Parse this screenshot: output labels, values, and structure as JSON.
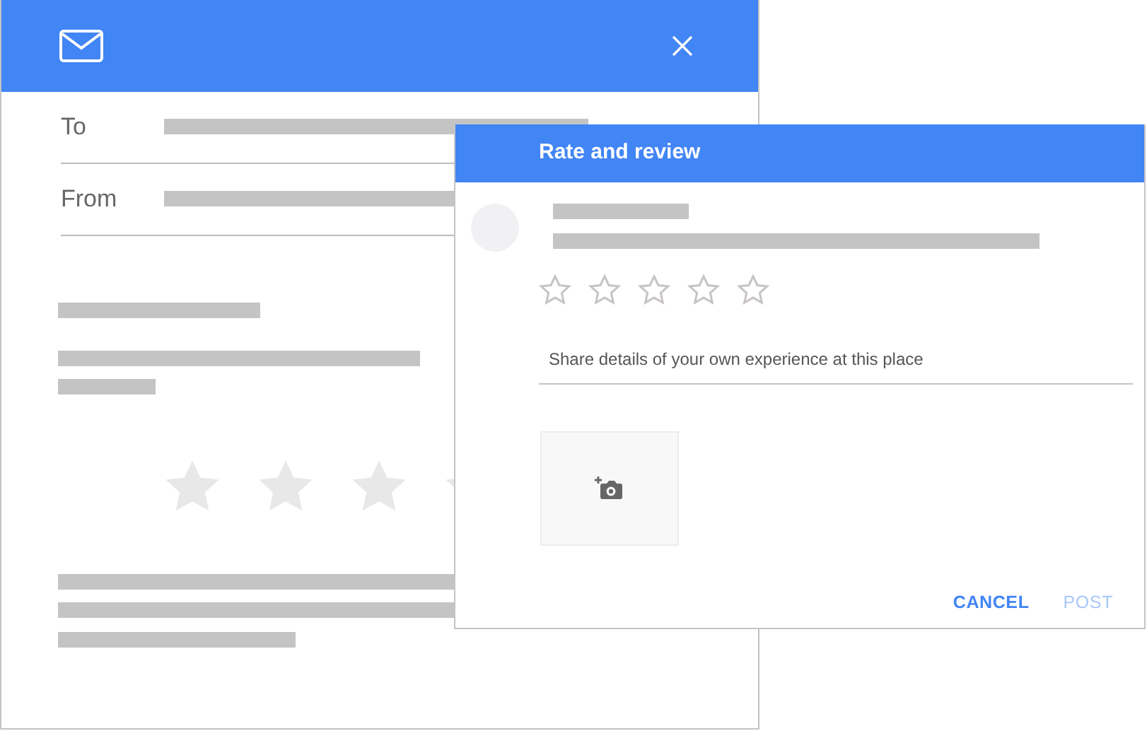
{
  "email_window": {
    "fields": [
      {
        "label": "To"
      },
      {
        "label": "From"
      }
    ]
  },
  "review_dialog": {
    "title": "Rate and review",
    "stars": 0,
    "placeholder": "Share details of your own experience at this place",
    "buttons": [
      {
        "label": "CANCEL",
        "disabled": false
      },
      {
        "label": "POST",
        "disabled": true
      }
    ]
  }
}
